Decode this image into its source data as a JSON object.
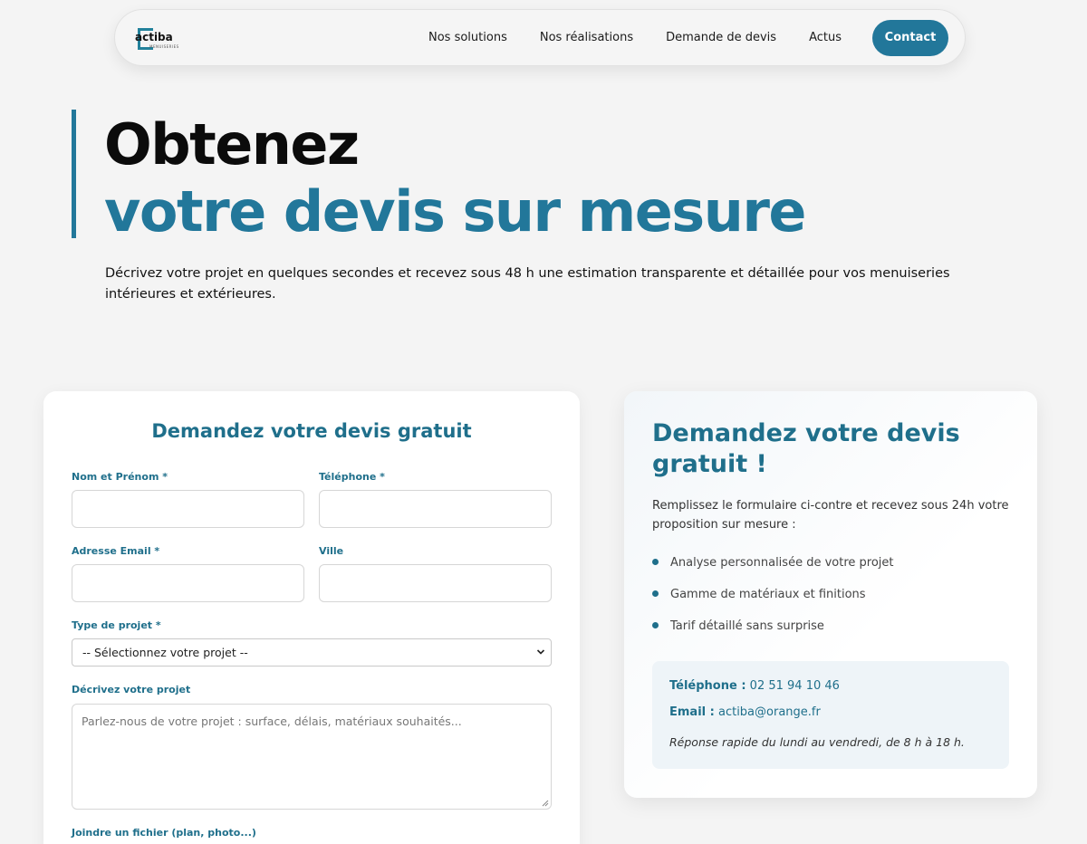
{
  "nav": {
    "logo_text": "actiba",
    "logo_subtext": "MENUISERIES",
    "links": [
      "Nos solutions",
      "Nos réalisations",
      "Demande de devis",
      "Actus"
    ],
    "contact_label": "Contact"
  },
  "hero": {
    "title_line1": "Obtenez",
    "title_line2": "votre devis sur mesure",
    "description": "Décrivez votre projet en quelques secondes et recevez sous 48 h une estimation transparente et détaillée pour vos menuiseries intérieures et extérieures."
  },
  "form": {
    "title": "Demandez votre devis gratuit",
    "name_label": "Nom et Prénom *",
    "phone_label": "Téléphone *",
    "email_label": "Adresse Email *",
    "city_label": "Ville",
    "project_type_label": "Type de projet *",
    "project_type_value": "-- Sélectionnez votre projet --",
    "description_label": "Décrivez votre projet",
    "description_placeholder": "Parlez-nous de votre projet : surface, délais, matériaux souhaités...",
    "file_label": "Joindre un fichier (plan, photo...)"
  },
  "info": {
    "title": "Demandez votre devis gratuit !",
    "description": "Remplissez le formulaire ci-contre et recevez sous 24h votre proposition sur mesure :",
    "bullets": [
      "Analyse personnalisée de votre projet",
      "Gamme de matériaux et finitions",
      "Tarif détaillé sans surprise"
    ],
    "phone_label": "Téléphone :",
    "phone_value": "02 51 94 10 46",
    "email_label": "Email :",
    "email_value": "actiba@orange.fr",
    "note": "Réponse rapide du lundi au vendredi, de 8 h à 18 h."
  },
  "colors": {
    "accent": "#22779a",
    "background": "#f4f4f4"
  }
}
